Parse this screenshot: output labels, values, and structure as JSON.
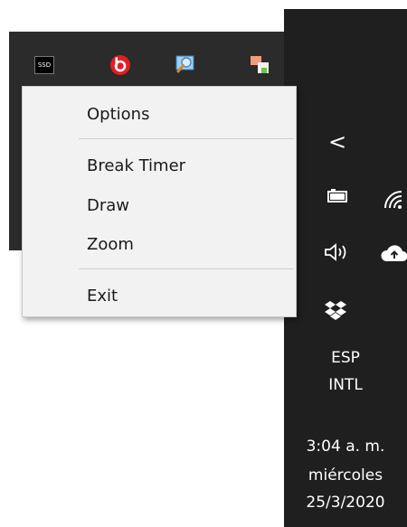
{
  "tray_overflow": {
    "icons": [
      {
        "name": "ssd-icon",
        "label": "SSD"
      },
      {
        "name": "beats-icon"
      },
      {
        "name": "zoomit-icon"
      },
      {
        "name": "app-windows-icon"
      }
    ]
  },
  "context_menu": {
    "items": [
      {
        "label": "Options"
      },
      {
        "label": "Break Timer"
      },
      {
        "label": "Draw"
      },
      {
        "label": "Zoom"
      },
      {
        "label": "Exit"
      }
    ]
  },
  "taskbar": {
    "chevron": "<",
    "language": {
      "line1": "ESP",
      "line2": "INTL"
    },
    "clock": {
      "time": "3:04 a. m.",
      "day": "miércoles",
      "date": "25/3/2020"
    }
  }
}
